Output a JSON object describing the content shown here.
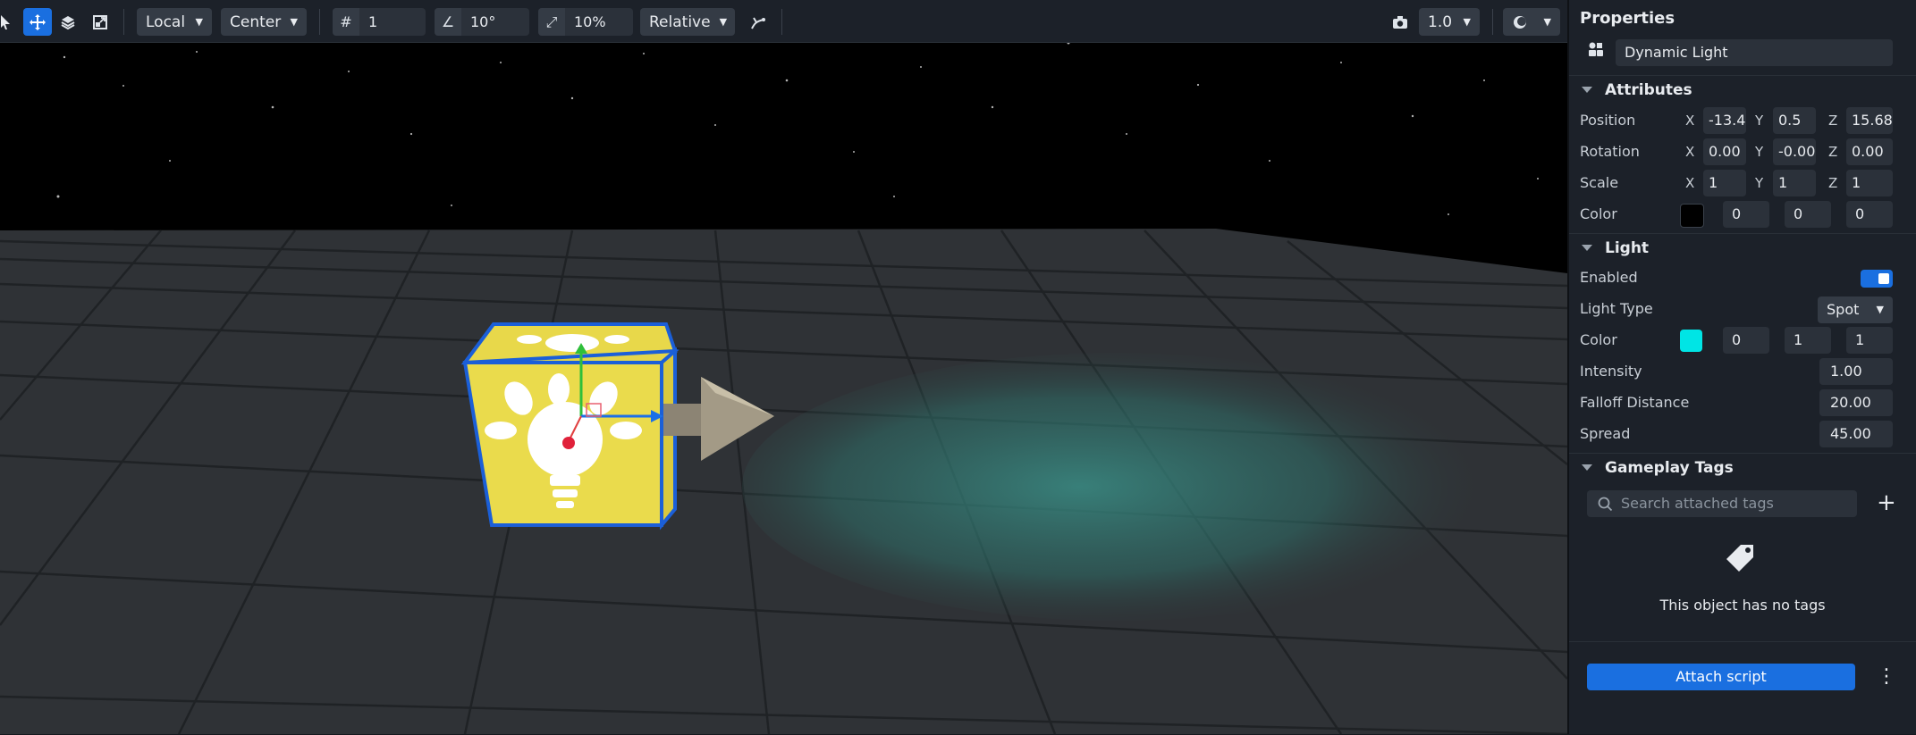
{
  "toolbar": {
    "space_mode": "Local",
    "pivot_mode": "Center",
    "grid_snap": "1",
    "rotation_snap": "10°",
    "scale_snap": "10%",
    "transform_mode": "Relative",
    "camera_speed": "1.0"
  },
  "properties": {
    "title": "Properties",
    "object_name": "Dynamic Light",
    "attributes": {
      "header": "Attributes",
      "position": {
        "label": "Position",
        "x": "-13.4",
        "y": "0.5",
        "z": "15.68"
      },
      "rotation": {
        "label": "Rotation",
        "x": "0.00",
        "y": "-0.00",
        "z": "0.00"
      },
      "scale": {
        "label": "Scale",
        "x": "1",
        "y": "1",
        "z": "1"
      },
      "color": {
        "label": "Color",
        "swatch": "#000000",
        "r": "0",
        "g": "0",
        "b": "0"
      }
    },
    "light": {
      "header": "Light",
      "enabled_label": "Enabled",
      "enabled": true,
      "type_label": "Light Type",
      "type": "Spot",
      "color_label": "Color",
      "color_swatch": "#00e5e5",
      "r": "0",
      "g": "1",
      "b": "1",
      "intensity_label": "Intensity",
      "intensity": "1.00",
      "falloff_label": "Falloff Distance",
      "falloff": "20.00",
      "spread_label": "Spread",
      "spread": "45.00"
    },
    "tags": {
      "header": "Gameplay Tags",
      "search_placeholder": "Search attached tags",
      "empty_text": "This object has no tags"
    },
    "attach_label": "Attach script"
  },
  "axis": {
    "x": "X",
    "y": "Y",
    "z": "Z"
  },
  "colors": {
    "accent": "#1a6fe0",
    "cube": "#e8d84a",
    "beam": "#2f8f86"
  }
}
